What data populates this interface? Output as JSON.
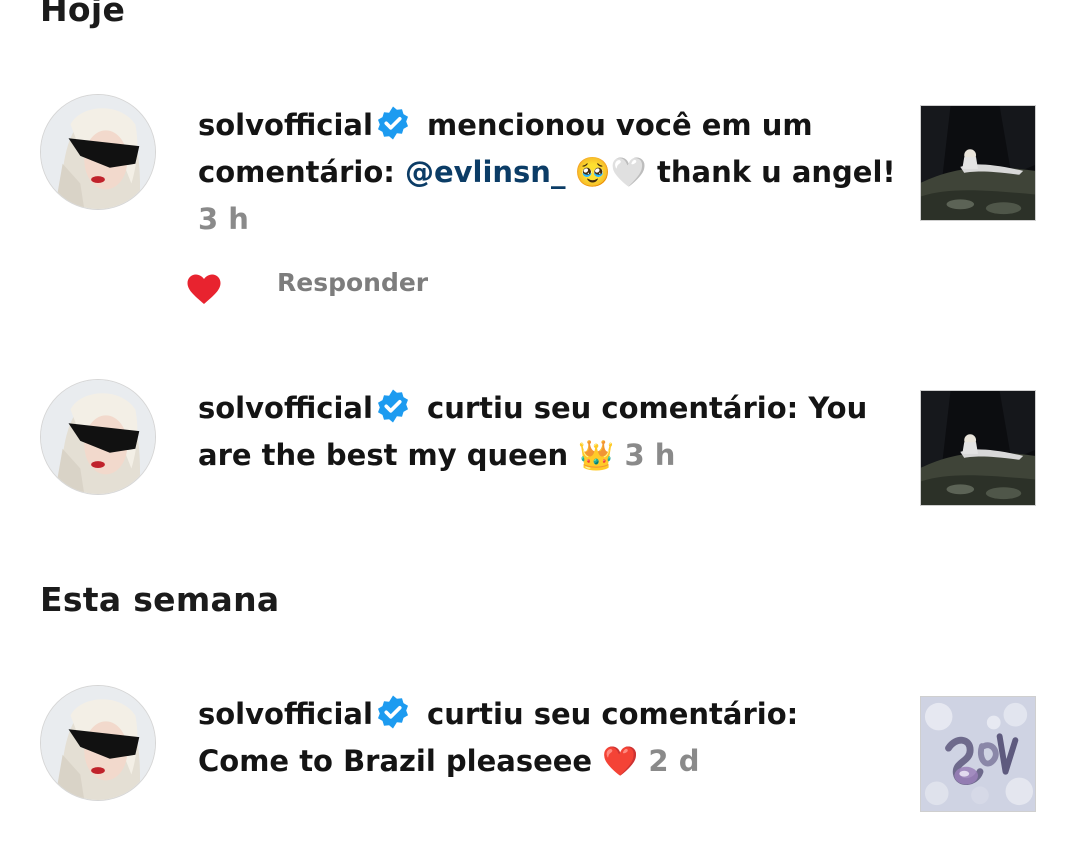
{
  "sections": {
    "today": "Hoje",
    "this_week": "Esta semana"
  },
  "colors": {
    "verified": "#1d9bf0",
    "mention": "#0b3c66",
    "time": "#8a8a8a",
    "like_heart": "#e8232f"
  },
  "notifications": [
    {
      "username": "solvofficial",
      "action": " mencionou você em um comentário: ",
      "mention": "@evlinsn_",
      "emojis": " 🥹🤍",
      "message": " thank u angel!",
      "time": "3 h",
      "reply_label": "Responder",
      "liked": true,
      "thumbnail": "dark-forest-photo"
    },
    {
      "username": "solvofficial",
      "action": " curtiu seu comentário: You are the best my queen ",
      "emoji": "👑",
      "time": "3 h",
      "thumbnail": "dark-forest-photo"
    },
    {
      "username": "solvofficial",
      "action": " curtiu seu comentário: Come to Brazil pleaseee ",
      "emoji": "❤️",
      "time": "2 d",
      "thumbnail": "chrome-logo-art"
    }
  ]
}
